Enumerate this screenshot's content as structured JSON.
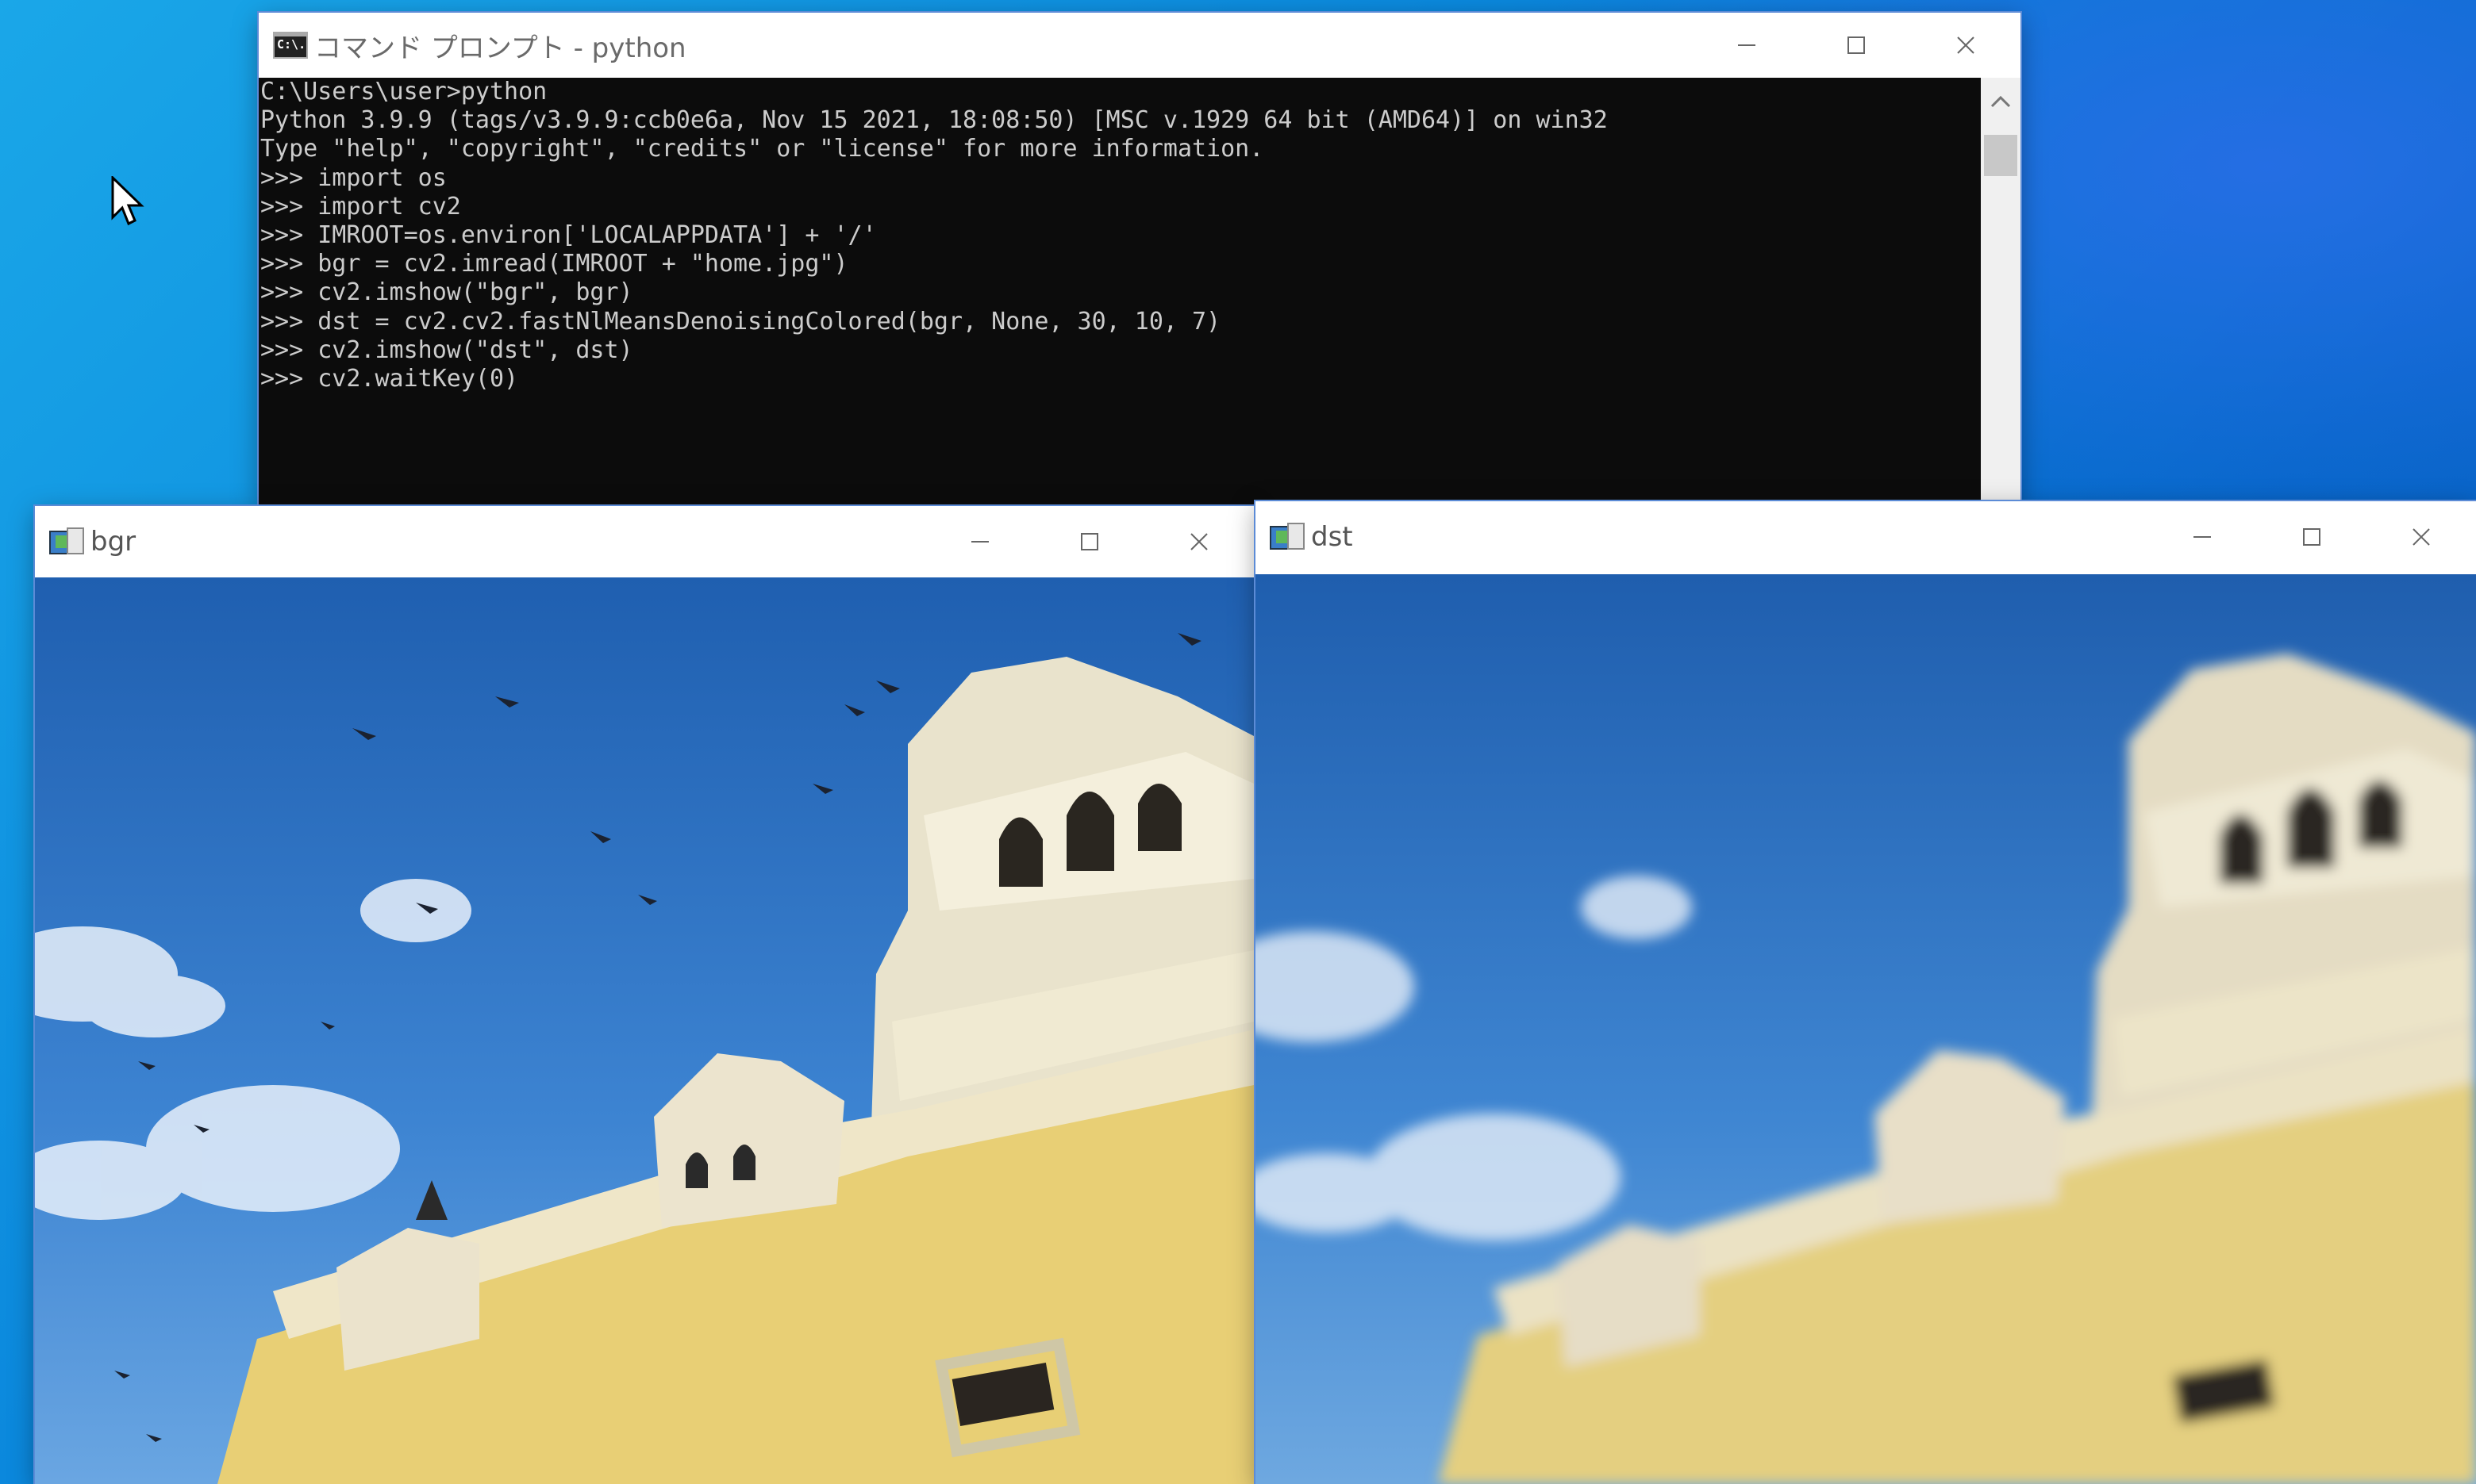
{
  "console": {
    "title": "コマンド プロンプト - python",
    "icon_text": "C:\\.",
    "lines": [
      "C:\\Users\\user>python",
      "Python 3.9.9 (tags/v3.9.9:ccb0e6a, Nov 15 2021, 18:08:50) [MSC v.1929 64 bit (AMD64)] on win32",
      "Type \"help\", \"copyright\", \"credits\" or \"license\" for more information.",
      ">>> import os",
      ">>> import cv2",
      ">>> IMROOT=os.environ['LOCALAPPDATA'] + '/'",
      ">>> bgr = cv2.imread(IMROOT + \"home.jpg\")",
      ">>> cv2.imshow(\"bgr\", bgr)",
      ">>> dst = cv2.cv2.fastNlMeansDenoisingColored(bgr, None, 30, 10, 7)",
      ">>> cv2.imshow(\"dst\", dst)",
      ">>> cv2.waitKey(0)"
    ]
  },
  "windows": {
    "bgr": {
      "title": "bgr",
      "image": "Yellow palace towers with pigeons against blue sky (original)"
    },
    "dst": {
      "title": "dst",
      "image": "Yellow palace towers with pigeons against blue sky (denoised, smoothed)"
    }
  },
  "caption_buttons": {
    "minimize": "—",
    "maximize": "☐",
    "close": "✕"
  },
  "icons": [
    "cmd-icon",
    "opencv-window-icon",
    "minimize-icon",
    "maximize-icon",
    "close-icon",
    "scroll-up-arrow-icon",
    "mouse-cursor-icon"
  ],
  "colors": {
    "console_bg": "#0c0c0c",
    "console_fg": "#cccccc",
    "desktop": "#0a86dc"
  }
}
